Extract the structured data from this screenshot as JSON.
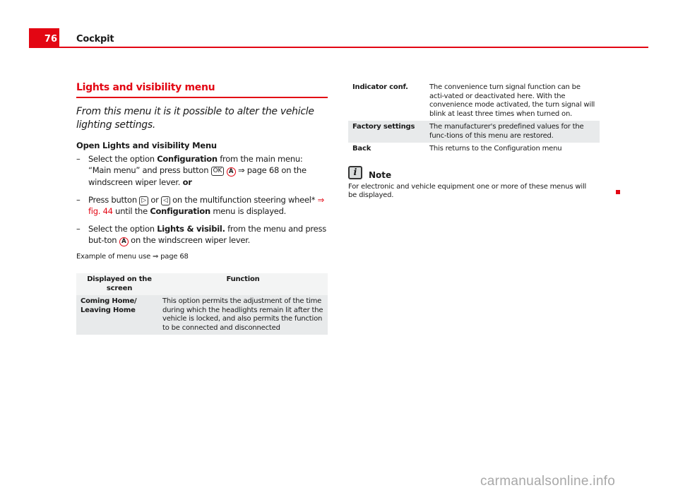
{
  "header": {
    "page_number": "76",
    "section": "Cockpit",
    "accent_color": "#e30613"
  },
  "left": {
    "title": "Lights and visibility menu",
    "intro": "From this menu it is it possible to alter the vehicle lighting settings.",
    "subheading": "Open Lights and visibility Menu",
    "steps": [
      {
        "dash": "–",
        "t1": "Select the option ",
        "bold1": "Configuration",
        "t2": " from the main menu: “Main menu” and press button ",
        "btn_ok": "OK",
        "btn_a": "A",
        "t3": " ⇒ page 68 on the windscreen wiper lever. ",
        "bold_or": "or"
      },
      {
        "dash": "–",
        "t1": "Press button ",
        "btn_next": "▷",
        "t2": " or ",
        "btn_prev": "◁",
        "t3": " on the multifunction steering wheel* ",
        "link": "⇒ fig. 44",
        "t4": " until the ",
        "bold1": "Configuration",
        "t5": " menu is displayed."
      },
      {
        "dash": "–",
        "t1": "Select the option ",
        "bold1": "Lights & visibil.",
        "t2": " from the menu and press but-ton ",
        "btn_a": "A",
        "t3": " on the windscreen wiper lever."
      }
    ],
    "example": "Example of menu use ⇒ page 68",
    "table": {
      "headers": [
        "Displayed on the screen",
        "Function"
      ],
      "rows": [
        {
          "item": "Coming Home/ Leaving Home",
          "function": "This option permits the adjustment of the time during which the headlights remain lit after the vehicle is locked, and also permits the function to be connected and disconnected"
        }
      ]
    }
  },
  "right": {
    "table": {
      "rows": [
        {
          "item": "Indicator conf.",
          "function": "The convenience turn signal function can be acti-vated or deactivated here. With the convenience mode activated, the turn signal will blink at least three times when turned on."
        },
        {
          "item": "Factory settings",
          "function": "The manufacturer's predefined values for the func-tions of this menu are restored."
        },
        {
          "item": "Back",
          "function": "This returns to the Configuration menu"
        }
      ]
    },
    "note": {
      "icon": "i",
      "title": "Note",
      "text": "For electronic and vehicle equipment one or more of these menus will be displayed."
    }
  },
  "watermark": "carmanualsonline.info"
}
